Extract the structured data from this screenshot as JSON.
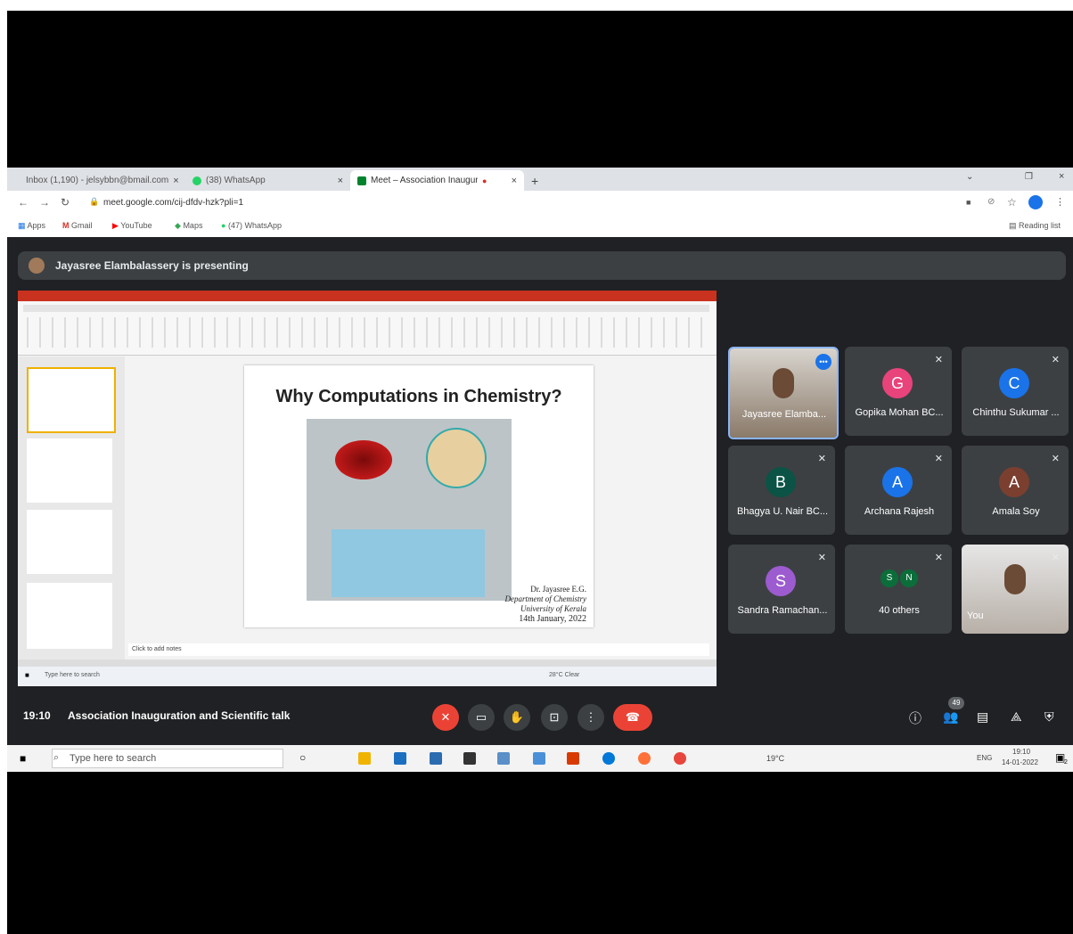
{
  "tabs": [
    {
      "label": "Inbox (1,190) - jelsybbn@bmail.com",
      "icon_color": "#d93025",
      "icon": "gmail-icon"
    },
    {
      "label": "(38) WhatsApp",
      "icon_color": "#25d366",
      "icon": "whatsapp-icon"
    },
    {
      "label": "Meet – Association Inaugura",
      "icon_color": "#00832d",
      "icon": "meet-icon"
    }
  ],
  "new_tab": "+",
  "address": "meet.google.com/cij-dfdv-hzk?pli=1",
  "bookmarks": [
    {
      "label": "Apps",
      "icon": "apps-icon"
    },
    {
      "label": "Gmail",
      "icon": "gmail-icon"
    },
    {
      "label": "YouTube",
      "icon": "youtube-icon"
    },
    {
      "label": "Maps",
      "icon": "maps-icon"
    },
    {
      "label": "(47) WhatsApp",
      "icon": "whatsapp-icon"
    }
  ],
  "reading_list": "Reading list",
  "presenting_text": "Jayasree Elambalassery is presenting",
  "slide": {
    "title": "Why Computations in Chemistry?",
    "credit_name": "Dr. Jayasree E.G.",
    "credit_dept": "Department of Chemistry",
    "credit_univ": "University of Kerala",
    "credit_date": "14th January, 2022",
    "notes": "Click to add notes",
    "search": "Type here to search",
    "weather": "28°C Clear"
  },
  "participants": [
    {
      "name": "Jayasree Elamba...",
      "initial": "",
      "color": "#5f6368",
      "video": true
    },
    {
      "name": "Gopika Mohan BC...",
      "initial": "G",
      "color": "#e8437b"
    },
    {
      "name": "Chinthu Sukumar ...",
      "initial": "C",
      "color": "#1a73e8"
    },
    {
      "name": "Bhagya U. Nair BC...",
      "initial": "B",
      "color": "#0b5345"
    },
    {
      "name": "Archana Rajesh",
      "initial": "A",
      "color": "#1a73e8"
    },
    {
      "name": "Amala Soy",
      "initial": "A",
      "color": "#7b3f30"
    },
    {
      "name": "Sandra Ramachan...",
      "initial": "S",
      "color": "#9c5bcf"
    },
    {
      "name": "40 others",
      "initial": "",
      "color": "",
      "others": [
        "S",
        "N"
      ]
    },
    {
      "name": "You",
      "initial": "",
      "color": "#5f6368",
      "video": true
    }
  ],
  "meeting": {
    "time": "19:10",
    "title": "Association Inauguration and Scientific talk",
    "participant_count": "49"
  },
  "taskbar": {
    "search": "Type here to search",
    "weather": "19°C",
    "lang": "ENG",
    "time": "19:10",
    "date": "14-01-2022",
    "notif": "2"
  }
}
